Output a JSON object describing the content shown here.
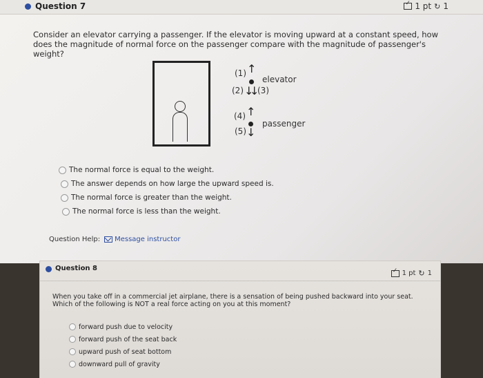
{
  "question7": {
    "title": "Question 7",
    "points": "1 pt",
    "attempts": "1",
    "prompt": "Consider an elevator carrying a passenger. If the elevator is moving upward at a constant speed, how does the magnitude of normal force on the passenger compare with the magnitude of passenger's weight?",
    "diagram": {
      "elevator_label": "elevator",
      "passenger_label": "passenger",
      "force_labels": [
        "(1)",
        "(2)",
        "(3)",
        "(4)",
        "(5)"
      ]
    },
    "choices": [
      "The normal force is equal to the weight.",
      "The answer depends on how large the upward speed is.",
      "The normal force is greater than the weight.",
      "The normal force is less than the weight."
    ],
    "help_label": "Question Help:",
    "help_link": "Message instructor"
  },
  "question8": {
    "title": "Question 8",
    "points": "1 pt",
    "attempts": "1",
    "prompt": "When you take off in a commercial jet airplane, there is a sensation of being pushed backward into your seat. Which of the following is NOT a real force acting on you at this moment?",
    "choices": [
      "forward push due to velocity",
      "forward push of the seat back",
      "upward push of seat bottom",
      "downward pull of gravity"
    ]
  },
  "colors": {
    "accent": "#2d4fa1"
  }
}
